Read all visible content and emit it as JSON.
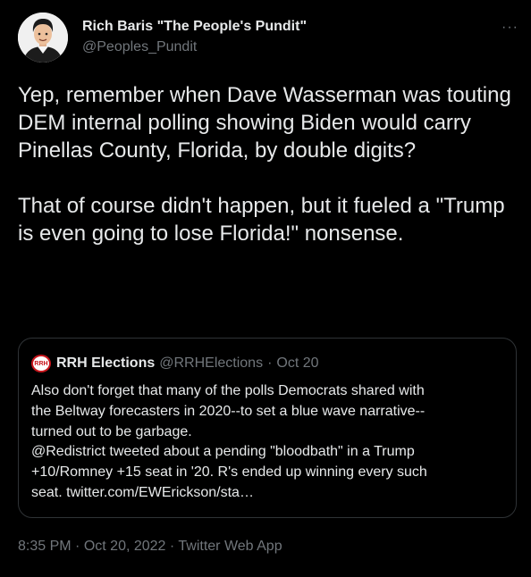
{
  "author": {
    "display_name": "Rich Baris \"The People's Pundit\"",
    "handle": "@Peoples_Pundit",
    "avatar_icon": "cartoon-avatar-icon"
  },
  "more_icon": "···",
  "tweet": {
    "text": "Yep, remember when Dave Wasserman was touting DEM internal polling showing Biden would carry Pinellas County, Florida, by double digits?\n\nThat of course didn't happen, but it fueled a \"Trump is even going to lose Florida!\" nonsense."
  },
  "quote": {
    "logo_text": "RRH",
    "name": "RRH Elections",
    "handle": "@RRHElections",
    "separator": "·",
    "date": "Oct 20",
    "text": "Also don't forget that many of the polls Democrats shared with\nthe Beltway forecasters in 2020--to set a blue wave narrative--\nturned out to be garbage.\n@Redistrict tweeted about a pending \"bloodbath\" in a Trump\n+10/Romney +15 seat in '20. R's ended up winning every such\nseat. twitter.com/EWErickson/sta…"
  },
  "meta": {
    "time": "8:35 PM",
    "separator": "·",
    "date": "Oct 20, 2022",
    "source": "Twitter Web App"
  },
  "colors": {
    "background": "#000000",
    "text": "#e7e9ea",
    "secondary": "#71767b",
    "border": "#2f3336",
    "logo_red": "#c8161d"
  }
}
